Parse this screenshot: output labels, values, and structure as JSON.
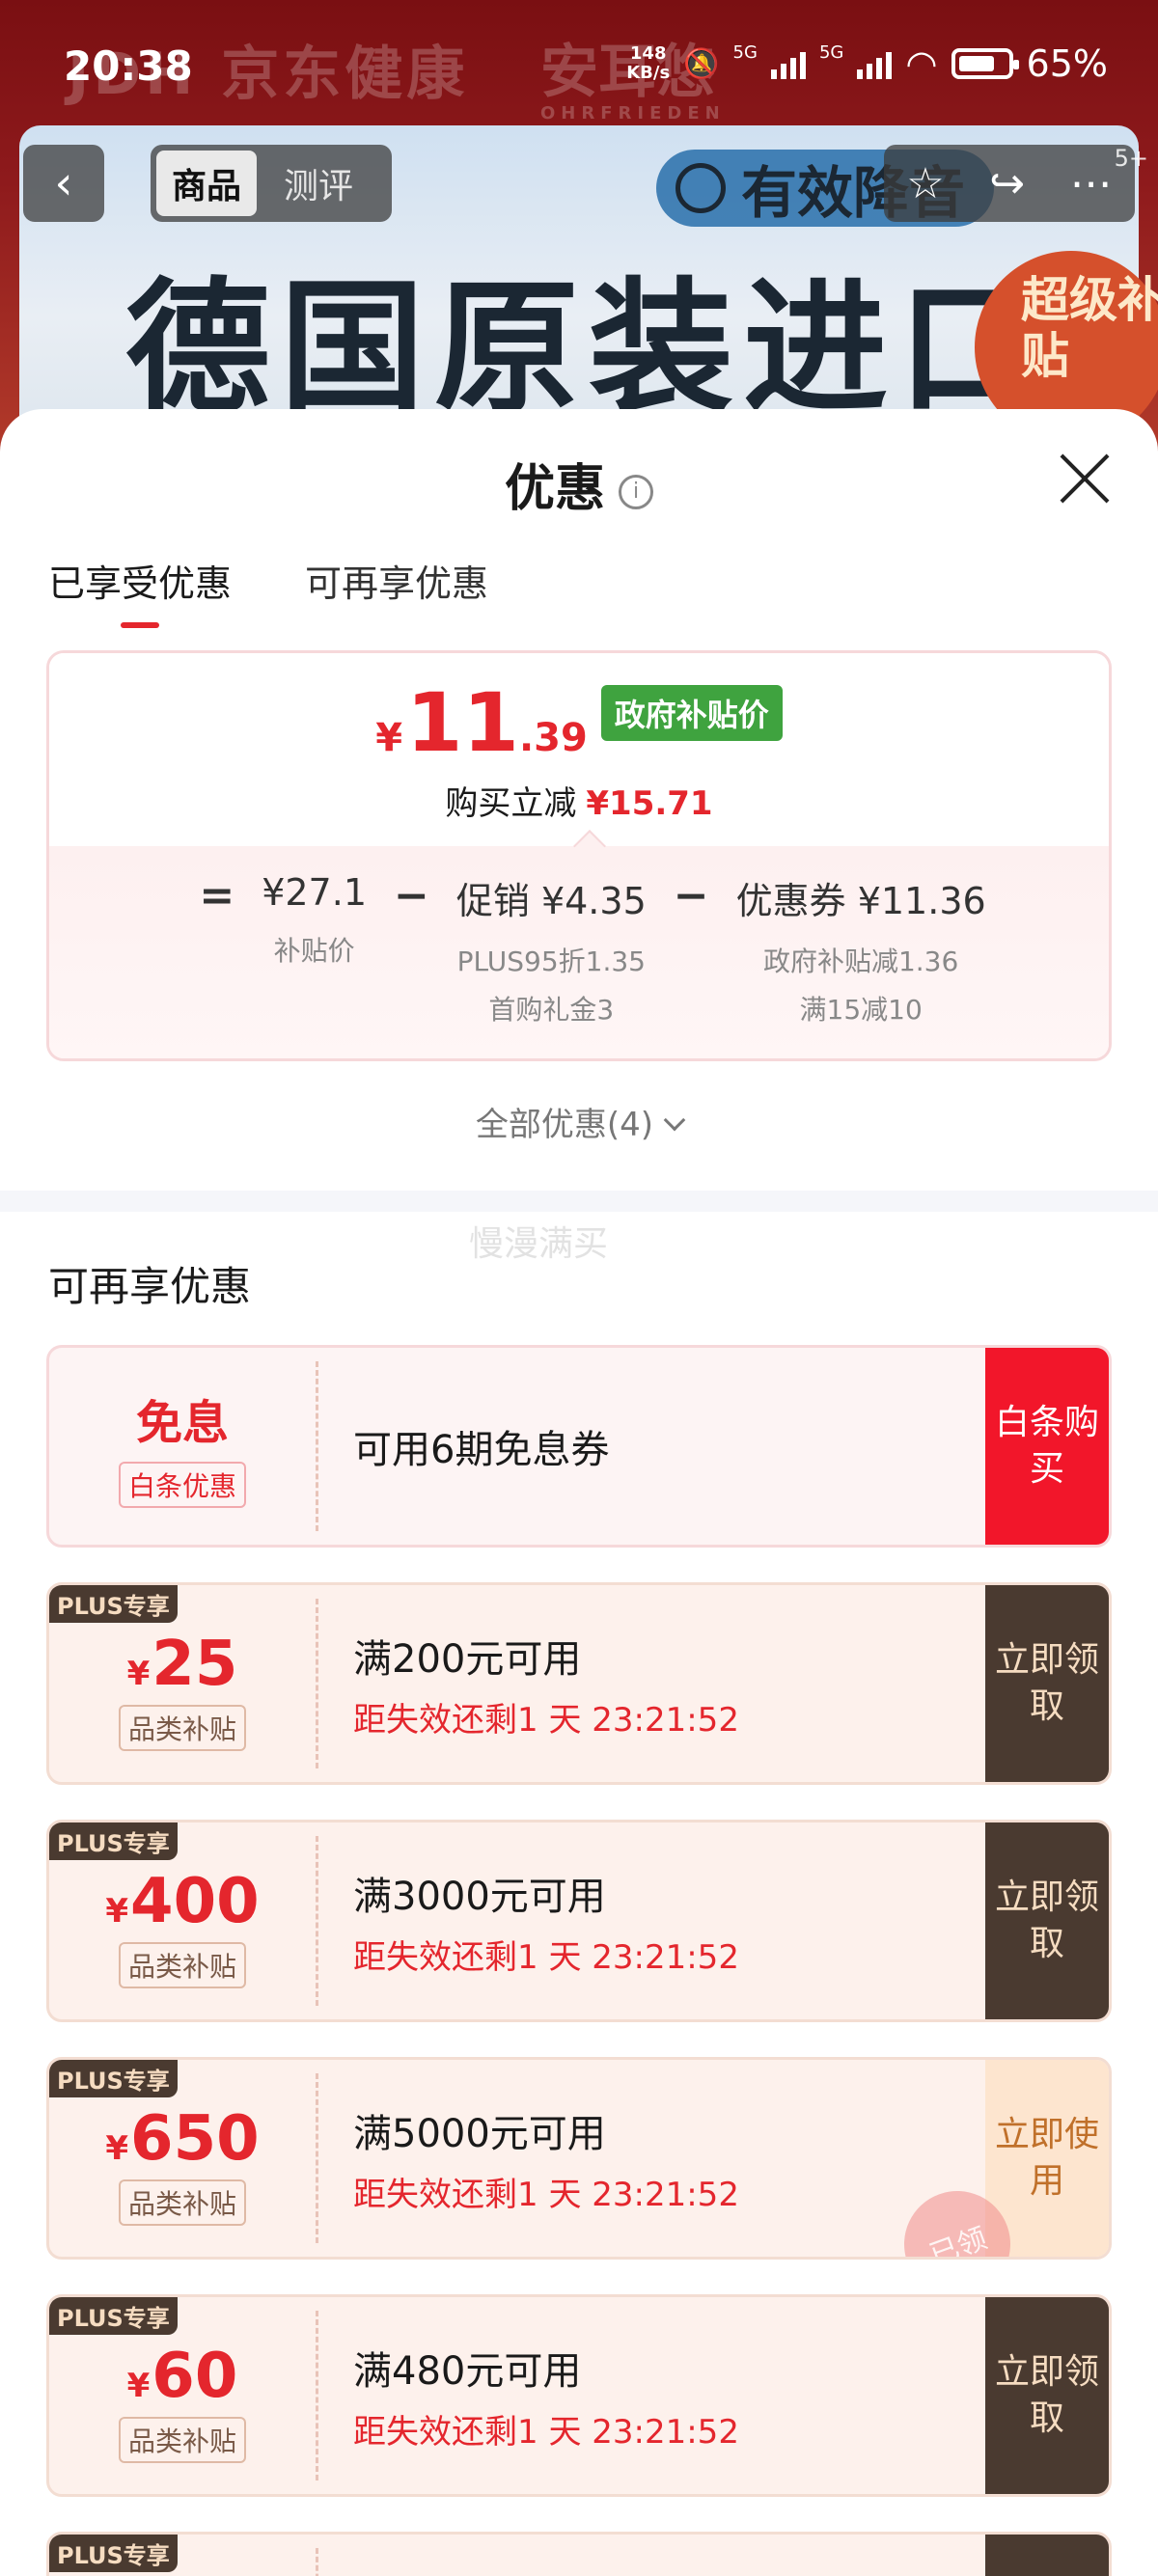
{
  "status": {
    "time": "20:38",
    "speed": "148",
    "speed_unit": "KB/s",
    "battery": "65%",
    "net1": "5G",
    "net2": "5G"
  },
  "background": {
    "brand": "JDH 京东健康",
    "brand2": "安耳悠",
    "brand2_sub": "OHRFRIEDEN",
    "slogan": "德国原装进口",
    "noise_label": "有效降音",
    "super_label": "超级补贴",
    "badge": "5+"
  },
  "nav": {
    "back_icon": "chevron-left-icon",
    "tabs": [
      {
        "label": "商品"
      },
      {
        "label": "测评"
      }
    ],
    "star_icon": "star-icon",
    "share_icon": "share-icon",
    "more_icon": "more-icon"
  },
  "sheet": {
    "title": "优惠",
    "info_icon": "i",
    "tabs": [
      {
        "label": "已享受优惠"
      },
      {
        "label": "可再享优惠"
      }
    ],
    "summary": {
      "currency": "¥",
      "price_int": "11",
      "price_dec": ".39",
      "gov_tag": "政府补贴价",
      "reduce_label": "购买立减",
      "reduce_amount": "¥15.71",
      "eq": "=",
      "minus": "−",
      "cols": [
        {
          "main": "¥27.1",
          "sub": [
            "补贴价"
          ]
        },
        {
          "main": "促销 ¥4.35",
          "sub": [
            "PLUS95折1.35",
            "首购礼金3"
          ]
        },
        {
          "main": "优惠券 ¥11.36",
          "sub": [
            "政府补贴减1.36",
            "满15减10"
          ]
        }
      ]
    },
    "all_promos": "全部优惠(4)",
    "watermark": "慢漫满买",
    "section_title": "可再享优惠",
    "baitiao": {
      "big": "免息",
      "tag": "白条优惠",
      "title": "可用6期免息券",
      "action": "白条购买"
    },
    "plus_tag": "PLUS专享",
    "coupons": [
      {
        "currency": "¥",
        "amount": "25",
        "category": "品类补贴",
        "condition": "满200元可用",
        "expire": "距失效还剩1 天 23:21:52",
        "action": "立即领取",
        "claimed": false
      },
      {
        "currency": "¥",
        "amount": "400",
        "category": "品类补贴",
        "condition": "满3000元可用",
        "expire": "距失效还剩1 天 23:21:52",
        "action": "立即领取",
        "claimed": false
      },
      {
        "currency": "¥",
        "amount": "650",
        "category": "品类补贴",
        "condition": "满5000元可用",
        "expire": "距失效还剩1 天 23:21:52",
        "action": "立即使用",
        "claimed": true,
        "stamp": "已领"
      },
      {
        "currency": "¥",
        "amount": "60",
        "category": "品类补贴",
        "condition": "满480元可用",
        "expire": "距失效还剩1 天 23:21:52",
        "action": "立即领取",
        "claimed": false
      }
    ]
  },
  "colors": {
    "accent": "#e4262d",
    "gov_green": "#3fa33f",
    "plus_dark": "#4a3a30",
    "plus_gold": "#f6dcc1"
  }
}
